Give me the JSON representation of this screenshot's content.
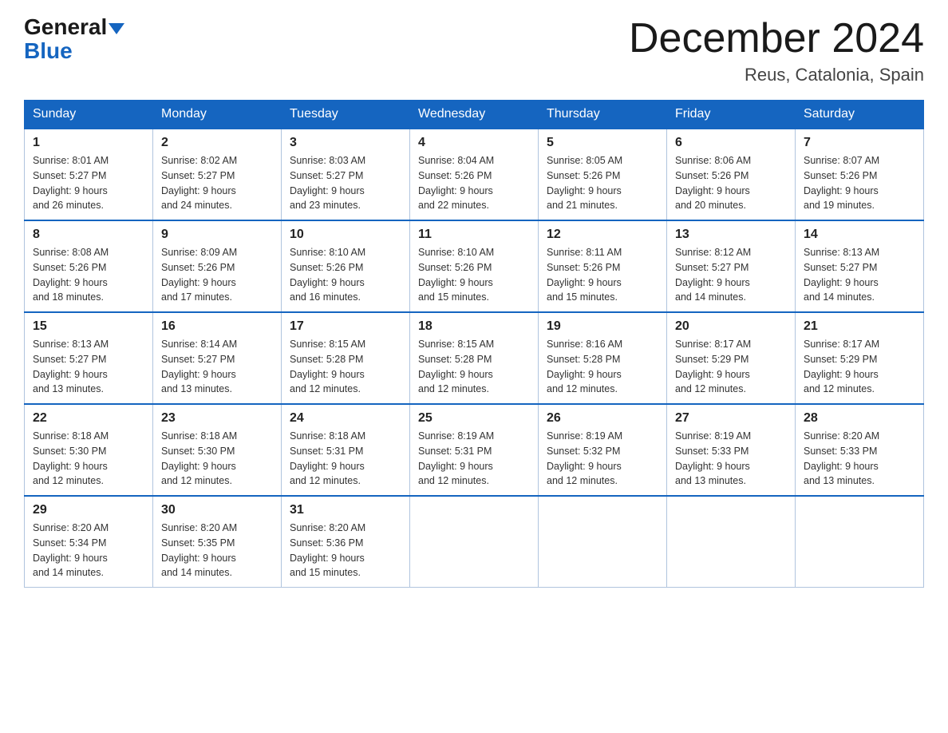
{
  "header": {
    "logo_general": "General",
    "logo_blue": "Blue",
    "main_title": "December 2024",
    "subtitle": "Reus, Catalonia, Spain"
  },
  "calendar": {
    "days_of_week": [
      "Sunday",
      "Monday",
      "Tuesday",
      "Wednesday",
      "Thursday",
      "Friday",
      "Saturday"
    ],
    "weeks": [
      [
        {
          "day": "1",
          "sunrise": "8:01 AM",
          "sunset": "5:27 PM",
          "daylight": "9 hours and 26 minutes."
        },
        {
          "day": "2",
          "sunrise": "8:02 AM",
          "sunset": "5:27 PM",
          "daylight": "9 hours and 24 minutes."
        },
        {
          "day": "3",
          "sunrise": "8:03 AM",
          "sunset": "5:27 PM",
          "daylight": "9 hours and 23 minutes."
        },
        {
          "day": "4",
          "sunrise": "8:04 AM",
          "sunset": "5:26 PM",
          "daylight": "9 hours and 22 minutes."
        },
        {
          "day": "5",
          "sunrise": "8:05 AM",
          "sunset": "5:26 PM",
          "daylight": "9 hours and 21 minutes."
        },
        {
          "day": "6",
          "sunrise": "8:06 AM",
          "sunset": "5:26 PM",
          "daylight": "9 hours and 20 minutes."
        },
        {
          "day": "7",
          "sunrise": "8:07 AM",
          "sunset": "5:26 PM",
          "daylight": "9 hours and 19 minutes."
        }
      ],
      [
        {
          "day": "8",
          "sunrise": "8:08 AM",
          "sunset": "5:26 PM",
          "daylight": "9 hours and 18 minutes."
        },
        {
          "day": "9",
          "sunrise": "8:09 AM",
          "sunset": "5:26 PM",
          "daylight": "9 hours and 17 minutes."
        },
        {
          "day": "10",
          "sunrise": "8:10 AM",
          "sunset": "5:26 PM",
          "daylight": "9 hours and 16 minutes."
        },
        {
          "day": "11",
          "sunrise": "8:10 AM",
          "sunset": "5:26 PM",
          "daylight": "9 hours and 15 minutes."
        },
        {
          "day": "12",
          "sunrise": "8:11 AM",
          "sunset": "5:26 PM",
          "daylight": "9 hours and 15 minutes."
        },
        {
          "day": "13",
          "sunrise": "8:12 AM",
          "sunset": "5:27 PM",
          "daylight": "9 hours and 14 minutes."
        },
        {
          "day": "14",
          "sunrise": "8:13 AM",
          "sunset": "5:27 PM",
          "daylight": "9 hours and 14 minutes."
        }
      ],
      [
        {
          "day": "15",
          "sunrise": "8:13 AM",
          "sunset": "5:27 PM",
          "daylight": "9 hours and 13 minutes."
        },
        {
          "day": "16",
          "sunrise": "8:14 AM",
          "sunset": "5:27 PM",
          "daylight": "9 hours and 13 minutes."
        },
        {
          "day": "17",
          "sunrise": "8:15 AM",
          "sunset": "5:28 PM",
          "daylight": "9 hours and 12 minutes."
        },
        {
          "day": "18",
          "sunrise": "8:15 AM",
          "sunset": "5:28 PM",
          "daylight": "9 hours and 12 minutes."
        },
        {
          "day": "19",
          "sunrise": "8:16 AM",
          "sunset": "5:28 PM",
          "daylight": "9 hours and 12 minutes."
        },
        {
          "day": "20",
          "sunrise": "8:17 AM",
          "sunset": "5:29 PM",
          "daylight": "9 hours and 12 minutes."
        },
        {
          "day": "21",
          "sunrise": "8:17 AM",
          "sunset": "5:29 PM",
          "daylight": "9 hours and 12 minutes."
        }
      ],
      [
        {
          "day": "22",
          "sunrise": "8:18 AM",
          "sunset": "5:30 PM",
          "daylight": "9 hours and 12 minutes."
        },
        {
          "day": "23",
          "sunrise": "8:18 AM",
          "sunset": "5:30 PM",
          "daylight": "9 hours and 12 minutes."
        },
        {
          "day": "24",
          "sunrise": "8:18 AM",
          "sunset": "5:31 PM",
          "daylight": "9 hours and 12 minutes."
        },
        {
          "day": "25",
          "sunrise": "8:19 AM",
          "sunset": "5:31 PM",
          "daylight": "9 hours and 12 minutes."
        },
        {
          "day": "26",
          "sunrise": "8:19 AM",
          "sunset": "5:32 PM",
          "daylight": "9 hours and 12 minutes."
        },
        {
          "day": "27",
          "sunrise": "8:19 AM",
          "sunset": "5:33 PM",
          "daylight": "9 hours and 13 minutes."
        },
        {
          "day": "28",
          "sunrise": "8:20 AM",
          "sunset": "5:33 PM",
          "daylight": "9 hours and 13 minutes."
        }
      ],
      [
        {
          "day": "29",
          "sunrise": "8:20 AM",
          "sunset": "5:34 PM",
          "daylight": "9 hours and 14 minutes."
        },
        {
          "day": "30",
          "sunrise": "8:20 AM",
          "sunset": "5:35 PM",
          "daylight": "9 hours and 14 minutes."
        },
        {
          "day": "31",
          "sunrise": "8:20 AM",
          "sunset": "5:36 PM",
          "daylight": "9 hours and 15 minutes."
        },
        null,
        null,
        null,
        null
      ]
    ]
  }
}
